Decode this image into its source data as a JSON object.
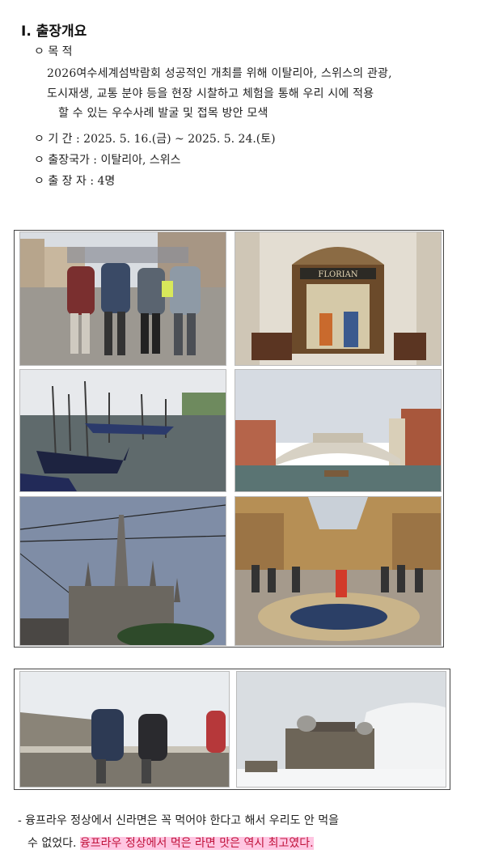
{
  "section": {
    "title": "I. 출장개요"
  },
  "overview": {
    "purpose_label": "ㅇ 목 적",
    "purpose_lines": [
      "2026여수세계섬박람회 성공적인 개최를 위해 이탈리아, 스위스의 관광,",
      "도시재생, 교통 분야 등을 현장 시찰하고 체험을 통해 우리 시에 적용",
      "할 수 있는 우수사례 발굴 및 접목 방안 모색"
    ],
    "period_label": "ㅇ 기 간 :",
    "period_value": "2025. 5. 16.(금) ~ 2025. 5. 24.(토)",
    "country_label": "ㅇ 출장국가 :",
    "country_value": "이탈리아, 스위스",
    "members_label": "ㅇ 출 장 자 :",
    "members_value": "4명"
  },
  "photos": [
    {
      "name": "photo-group-piazza",
      "scene": "group of four in St. Mark's Square"
    },
    {
      "name": "photo-caffe-florian",
      "scene": "Caffè Florian storefront"
    },
    {
      "name": "photo-gondolas",
      "scene": "gondolas moored in Venice"
    },
    {
      "name": "photo-rialto-bridge",
      "scene": "Rialto Bridge on Grand Canal"
    },
    {
      "name": "photo-milan-cathedral",
      "scene": "Milan Cathedral spires"
    },
    {
      "name": "photo-galleria",
      "scene": "Galleria Vittorio Emanuele II mosaic floor"
    },
    {
      "name": "photo-jungfrau-people",
      "scene": "two people on snowy summit"
    },
    {
      "name": "photo-jungfrau-observatory",
      "scene": "Sphinx observatory in snow"
    }
  ],
  "florian_sign": "FLORIAN",
  "note": {
    "line1": "- 융프라우 정상에서 신라면은 꼭 먹어야 한다고 해서 우리도 안 먹을",
    "line2_plain": "수 없었다.",
    "line2_highlight": "융프라우 정상에서 먹은 라면 맛은 역시 최고였다."
  },
  "colors": {
    "highlight_bg": "#ffc6e2",
    "highlight_text": "#c0143c"
  }
}
